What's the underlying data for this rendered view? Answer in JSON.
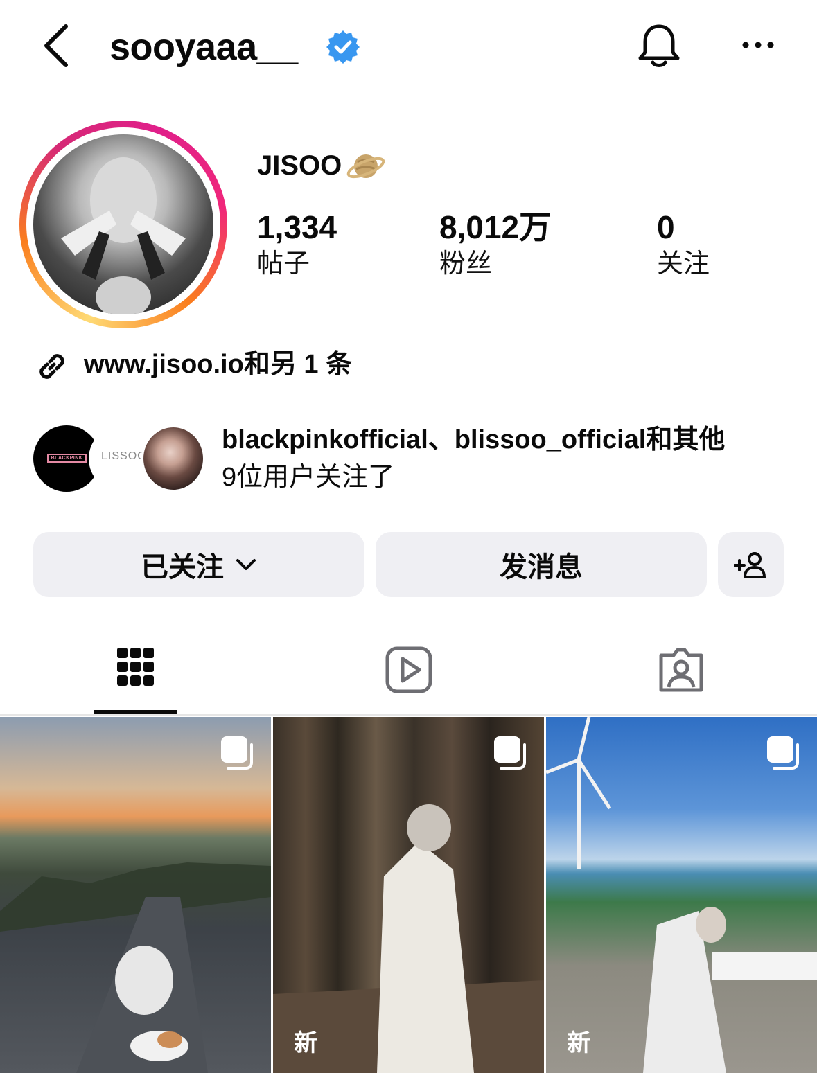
{
  "header": {
    "username": "sooyaaa__",
    "icons": {
      "back": "chevron-left-icon",
      "verified": "verified-badge-icon",
      "notifications": "bell-icon",
      "more": "more-horizontal-icon"
    },
    "accent_color": "#3897f0"
  },
  "profile": {
    "display_name": "JISOO",
    "display_name_emoji": "ringed-planet",
    "stats": [
      {
        "value": "1,334",
        "label": "帖子"
      },
      {
        "value": "8,012万",
        "label": "粉丝"
      },
      {
        "value": "0",
        "label": "关注"
      }
    ],
    "link": {
      "icon": "link-icon",
      "text": "www.jisoo.io和另 1 条"
    },
    "followed_by": {
      "avatars": [
        {
          "name": "blackpink-avatar",
          "label": "BLACKPINK"
        },
        {
          "name": "blissoo-avatar",
          "label": "LISSOO"
        },
        {
          "name": "mutual-avatar",
          "label": ""
        }
      ],
      "line1": "blackpinkofficial、blissoo_official和其他",
      "line2": "9位用户关注了"
    }
  },
  "actions": {
    "following_label": "已关注",
    "message_label": "发消息",
    "add_user_icon": "add-person-icon"
  },
  "tabs": [
    {
      "icon": "grid-icon",
      "active": true
    },
    {
      "icon": "reels-icon",
      "active": false
    },
    {
      "icon": "tagged-icon",
      "active": false
    }
  ],
  "posts": [
    {
      "type": "carousel",
      "new_label": ""
    },
    {
      "type": "carousel",
      "new_label": "新"
    },
    {
      "type": "carousel",
      "new_label": "新"
    }
  ]
}
